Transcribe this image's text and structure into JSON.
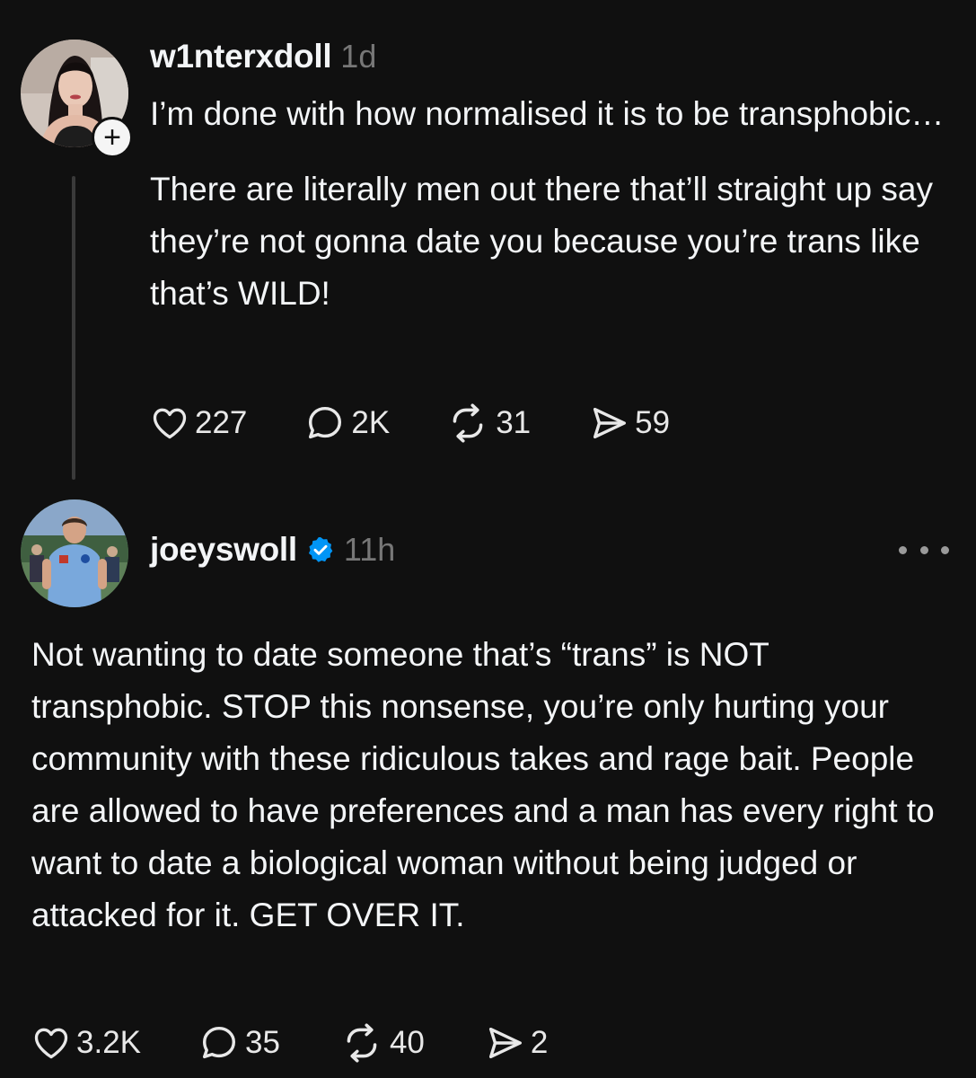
{
  "posts": [
    {
      "username": "w1nterxdoll",
      "timestamp": "1d",
      "paragraphs": [
        "I’m done with how normalised it is to be transphobic…",
        "There are literally men out there that’ll straight up say they’re not gonna date you because you’re trans like that’s WILD!"
      ],
      "follow_icon": "plus-icon",
      "stats": {
        "likes": "227",
        "replies": "2K",
        "reposts": "31",
        "shares": "59"
      }
    },
    {
      "username": "joeyswoll",
      "verified": true,
      "timestamp": "11h",
      "text": "Not wanting to date someone that’s “trans” is NOT transphobic. STOP this nonsense, you’re only hurting your community with these ridiculous takes and rage bait. People are allowed to have preferences and a man has every right to want to date a biological woman without being judged or attacked for it. GET OVER IT.",
      "stats": {
        "likes": "3.2K",
        "replies": "35",
        "reposts": "40",
        "shares": "2"
      }
    }
  ],
  "icons": {
    "like": "heart-icon",
    "reply": "comment-icon",
    "repost": "repost-icon",
    "share": "send-icon",
    "more": "more-dots-icon",
    "verified": "verified-badge-icon"
  },
  "colors": {
    "background": "#101010",
    "text": "#f3f5f7",
    "muted": "#777777",
    "verified": "#0095f6"
  }
}
